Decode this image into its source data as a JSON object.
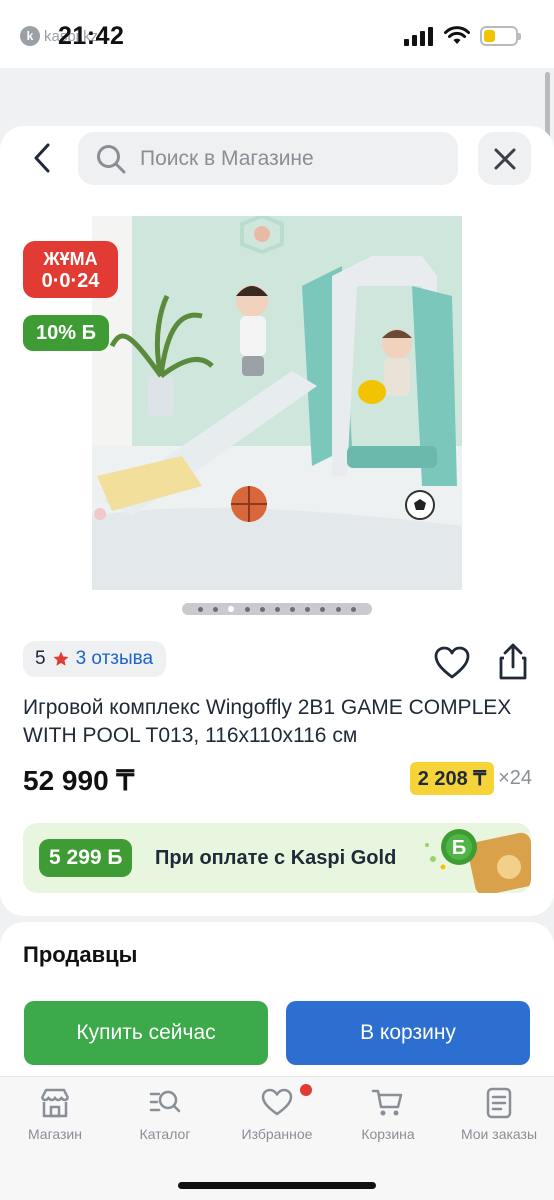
{
  "status_bar": {
    "app_name": "kaspi.kz",
    "time": "21:42"
  },
  "header": {
    "search_placeholder": "Поиск в Магазине"
  },
  "product": {
    "badge_line1": "ЖҰМА",
    "badge_line2": "0·0·24",
    "bonus_badge": "10% Б",
    "gallery": {
      "total_images": 11,
      "active_index": 3
    },
    "rating_value": "5",
    "reviews_link": "3 отзыва",
    "title": "Игровой комплекс Wingoffly 2В1 GAME COMPLEX WITH POOL T013, 116x110x116 см",
    "price": "52 990 ₸",
    "installment_amount": "2 208 ₸",
    "installment_months": "×24",
    "gold_bonus": "5 299 Б",
    "gold_text": "При оплате с Kaspi Gold"
  },
  "sellers": {
    "title": "Продавцы",
    "buy_now": "Купить сейчас",
    "add_to_cart": "В корзину"
  },
  "tab_bar": {
    "items": [
      {
        "label": "Магазин",
        "icon": "shop-icon"
      },
      {
        "label": "Каталог",
        "icon": "catalog-search-icon"
      },
      {
        "label": "Избранное",
        "icon": "heart-icon"
      },
      {
        "label": "Корзина",
        "icon": "cart-icon"
      },
      {
        "label": "Мои заказы",
        "icon": "orders-icon"
      }
    ]
  },
  "colors": {
    "brand_red": "#e23b33",
    "bonus_green": "#3f9c35",
    "buy_green": "#3caa4a",
    "cart_blue": "#2d6fd0",
    "installment_yellow": "#f7d33a"
  }
}
